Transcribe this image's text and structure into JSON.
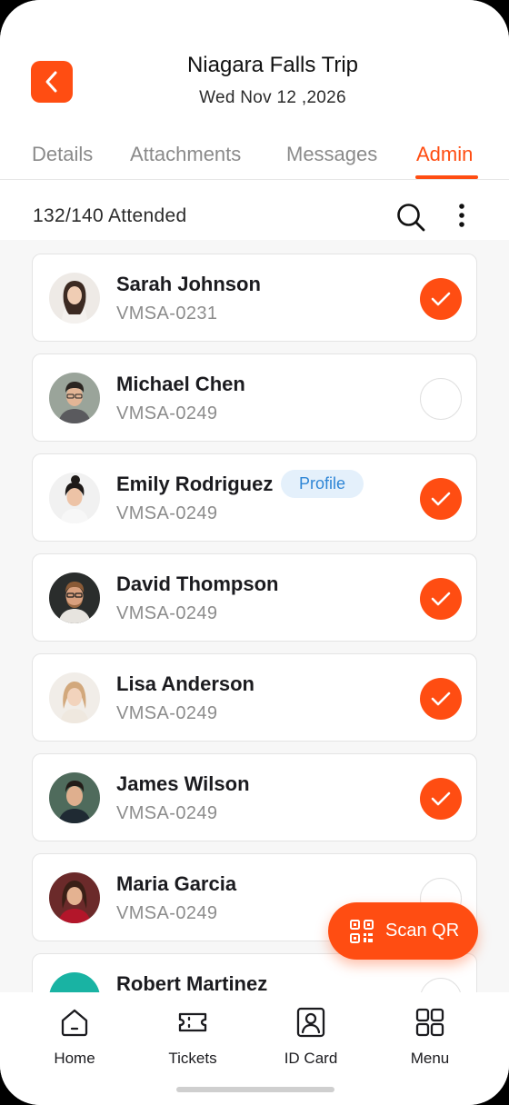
{
  "header": {
    "title": "Niagara Falls Trip",
    "date": "Wed Nov 12 ,2026"
  },
  "tabs": [
    {
      "label": "Details",
      "active": false
    },
    {
      "label": "Attachments",
      "active": false
    },
    {
      "label": "Messages",
      "active": false
    },
    {
      "label": "Admin",
      "active": true
    }
  ],
  "summary": {
    "attended_label": "132/140 Attended"
  },
  "attendees": [
    {
      "name": "Sarah Johnson",
      "code": "VMSA-0231",
      "checked": true
    },
    {
      "name": "Michael Chen",
      "code": "VMSA-0249",
      "checked": false
    },
    {
      "name": "Emily Rodriguez",
      "code": "VMSA-0249",
      "checked": true,
      "badge": "Profile"
    },
    {
      "name": "David Thompson",
      "code": "VMSA-0249",
      "checked": true
    },
    {
      "name": "Lisa Anderson",
      "code": "VMSA-0249",
      "checked": true
    },
    {
      "name": "James Wilson",
      "code": "VMSA-0249",
      "checked": true
    },
    {
      "name": "Maria Garcia",
      "code": "VMSA-0249",
      "checked": false
    },
    {
      "name": "Robert Martinez",
      "code": "",
      "checked": false
    }
  ],
  "fab": {
    "label": "Scan QR",
    "icon": "qr-code-icon"
  },
  "bottom_nav": [
    {
      "label": "Home",
      "icon": "home-icon"
    },
    {
      "label": "Tickets",
      "icon": "ticket-icon"
    },
    {
      "label": "ID Card",
      "icon": "id-card-icon"
    },
    {
      "label": "Menu",
      "icon": "grid-menu-icon"
    }
  ],
  "colors": {
    "accent": "#ff4d12",
    "badge_bg": "#e4f0fb",
    "badge_text": "#2f86d6",
    "muted_text": "#8c8c8c"
  }
}
